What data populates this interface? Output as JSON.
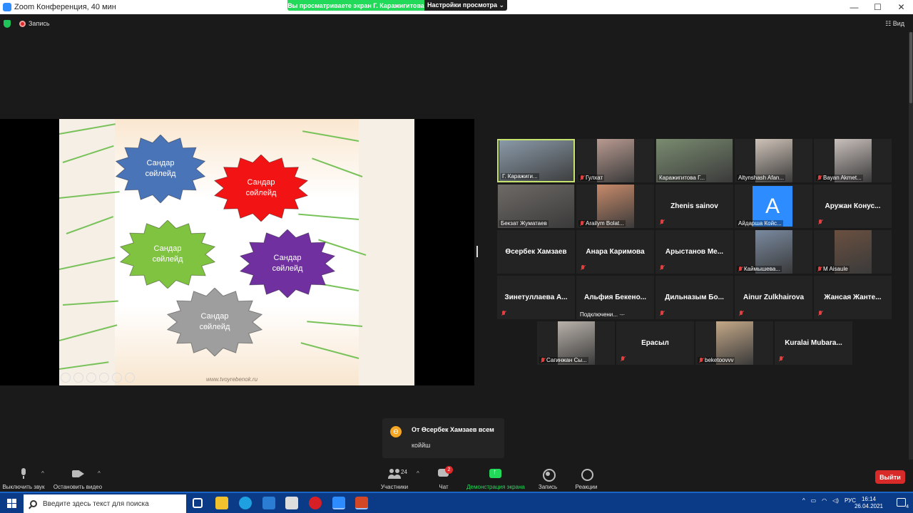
{
  "window": {
    "title": "Zoom Конференция, 40 мин",
    "controls": [
      "—",
      "☐",
      "✕"
    ]
  },
  "share_banner": {
    "viewing": "Вы просматриваете экран Г.  Каражигитова",
    "view_settings": "Настройки просмотра ⌄"
  },
  "topbar": {
    "recording": "Запись",
    "view": "Вид"
  },
  "slide": {
    "stars": [
      {
        "label": "Сандар\nсөйлейд",
        "color": "#4a74b8"
      },
      {
        "label": "Сандар\nсөйлейд",
        "color": "#f21414"
      },
      {
        "label": "Сандар\nсөйлейд",
        "color": "#80c341"
      },
      {
        "label": "Сандар\nсөйлейд",
        "color": "#7030a0"
      },
      {
        "label": "Сандар\nсөйлейд",
        "color": "#9e9e9e"
      }
    ],
    "watermark": "www.tvoyrebenok.ru"
  },
  "participants": [
    {
      "name": "Г.  Каражиги...",
      "video": true,
      "active": true,
      "muted": false,
      "pinned": true
    },
    {
      "name": "Гулхат",
      "video": true,
      "muted": true
    },
    {
      "name": "Каражигитова Г...",
      "video": true,
      "muted": false
    },
    {
      "name": "Altynshash Afan...",
      "video": true,
      "muted": false
    },
    {
      "name": "Bayan Akmet...",
      "video": true,
      "muted": true
    },
    {
      "name": "Бекзат Жуматаев",
      "video": true,
      "muted": false
    },
    {
      "name": "Arailym Bolat...",
      "video": true,
      "muted": true
    },
    {
      "name": "Zhenis sainov",
      "video": false,
      "muted": true
    },
    {
      "name": "Айдарша Койс...",
      "video": false,
      "avatar": "A",
      "muted": false
    },
    {
      "name": "Аружан  Конус...",
      "video": false,
      "muted": true
    },
    {
      "name": "Өсербек Хамзаев",
      "video": false,
      "muted": false
    },
    {
      "name": "Анара Каримова",
      "video": false,
      "muted": true
    },
    {
      "name": "Арыстанов  Ме...",
      "video": false,
      "muted": true
    },
    {
      "name": "Каймышева...",
      "video": true,
      "muted": true
    },
    {
      "name": "M Aisaule",
      "video": true,
      "muted": true
    },
    {
      "name": "Зинетуллаева  А...",
      "video": false,
      "muted": true
    },
    {
      "name": "Альфия  Бекено...",
      "video": false,
      "muted": false,
      "status": "Подключени... ·-·"
    },
    {
      "name": "Дильназым  Бо...",
      "video": false,
      "muted": true
    },
    {
      "name": "Ainur Zulkhairova",
      "video": false,
      "muted": true
    },
    {
      "name": "Жансая  Жанте...",
      "video": false,
      "muted": true
    },
    {
      "name": "Сагинжан Сы...",
      "video": true,
      "muted": true
    },
    {
      "name": "Ерасыл",
      "video": false,
      "muted": true
    },
    {
      "name": "beketoovvv",
      "video": true,
      "muted": true
    },
    {
      "name": "Kuralai  Mubara...",
      "video": false,
      "muted": true
    }
  ],
  "chat_toast": {
    "initial": "Ө",
    "from": "От Өсербек Хамзаев всем",
    "message": "коййш"
  },
  "toolbar": {
    "mute": "Выключить звук",
    "video": "Остановить видео",
    "participants": "Участники",
    "participants_count": "24",
    "chat": "Чат",
    "chat_badge": "2",
    "share": "Демонстрация экрана",
    "record": "Запись",
    "reactions": "Реакции",
    "leave": "Выйти"
  },
  "taskbar": {
    "search_placeholder": "Введите здесь текст для поиска",
    "lang": "РУС",
    "time": "16:14",
    "date": "26.04.2021",
    "notifications": "4"
  }
}
